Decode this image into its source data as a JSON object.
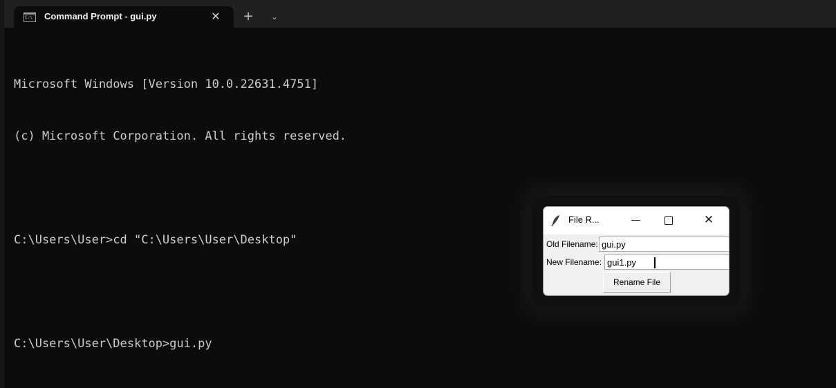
{
  "terminal": {
    "tab_icon_text": "C:\\",
    "tab_title": "Command Prompt - gui.py",
    "tab_close_glyph": "✕",
    "new_tab_glyph": "+",
    "dropdown_glyph": "⌄",
    "lines": [
      "Microsoft Windows [Version 10.0.22631.4751]",
      "(c) Microsoft Corporation. All rights reserved.",
      "",
      "C:\\Users\\User>cd \"C:\\Users\\User\\Desktop\"",
      "",
      "C:\\Users\\User\\Desktop>gui.py"
    ]
  },
  "dialog": {
    "title": "File R...",
    "old_label": "Old Filename:",
    "old_value": "gui.py",
    "new_label": "New Filename:",
    "new_value": "gui1.py",
    "rename_button": "Rename File",
    "close_glyph": "✕"
  },
  "icons": {
    "tab": "command-prompt-icon",
    "window": "tk-feather-icon"
  }
}
